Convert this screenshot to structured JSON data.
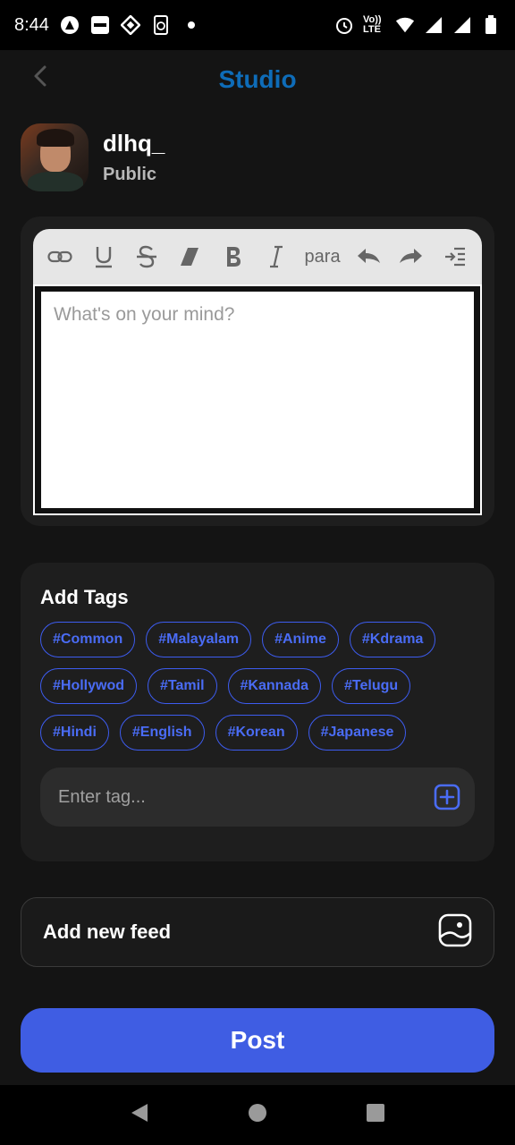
{
  "status_bar": {
    "time": "8:44",
    "left_icons": [
      "a-logo-icon",
      "blinkit-icon",
      "binance-icon",
      "phone-sync-icon",
      "dot-icon"
    ],
    "right_icons": [
      "alarm-icon",
      "volte-icon",
      "wifi-icon",
      "signal-icon",
      "signal-icon",
      "battery-icon"
    ],
    "volte_text": "Vo)) LTE"
  },
  "header": {
    "title": "Studio",
    "back_icon": "chevron-left-icon",
    "title_color": "#0e6cb8"
  },
  "profile": {
    "username": "dlhq_",
    "visibility": "Public"
  },
  "editor": {
    "toolbar": [
      {
        "name": "link-icon"
      },
      {
        "name": "underline-icon"
      },
      {
        "name": "strikethrough-icon"
      },
      {
        "name": "eraser-icon"
      },
      {
        "name": "bold-icon"
      },
      {
        "name": "italic-icon"
      },
      {
        "name": "para-label",
        "label": "para"
      },
      {
        "name": "undo-icon"
      },
      {
        "name": "redo-icon"
      },
      {
        "name": "indent-icon"
      }
    ],
    "placeholder": "What's on your mind?"
  },
  "tags": {
    "title": "Add Tags",
    "items": [
      "#Common",
      "#Malayalam",
      "#Anime",
      "#Kdrama",
      "#Hollywod",
      "#Tamil",
      "#Kannada",
      "#Telugu",
      "#Hindi",
      "#English",
      "#Korean",
      "#Japanese"
    ],
    "input_placeholder": "Enter tag...",
    "accent": "#3d5cf0"
  },
  "feed": {
    "label": "Add new feed",
    "icon": "image-add-icon"
  },
  "post": {
    "label": "Post",
    "color": "#3f5de3"
  },
  "nav": {
    "icons": [
      "back-triangle-icon",
      "home-circle-icon",
      "recents-square-icon"
    ]
  }
}
